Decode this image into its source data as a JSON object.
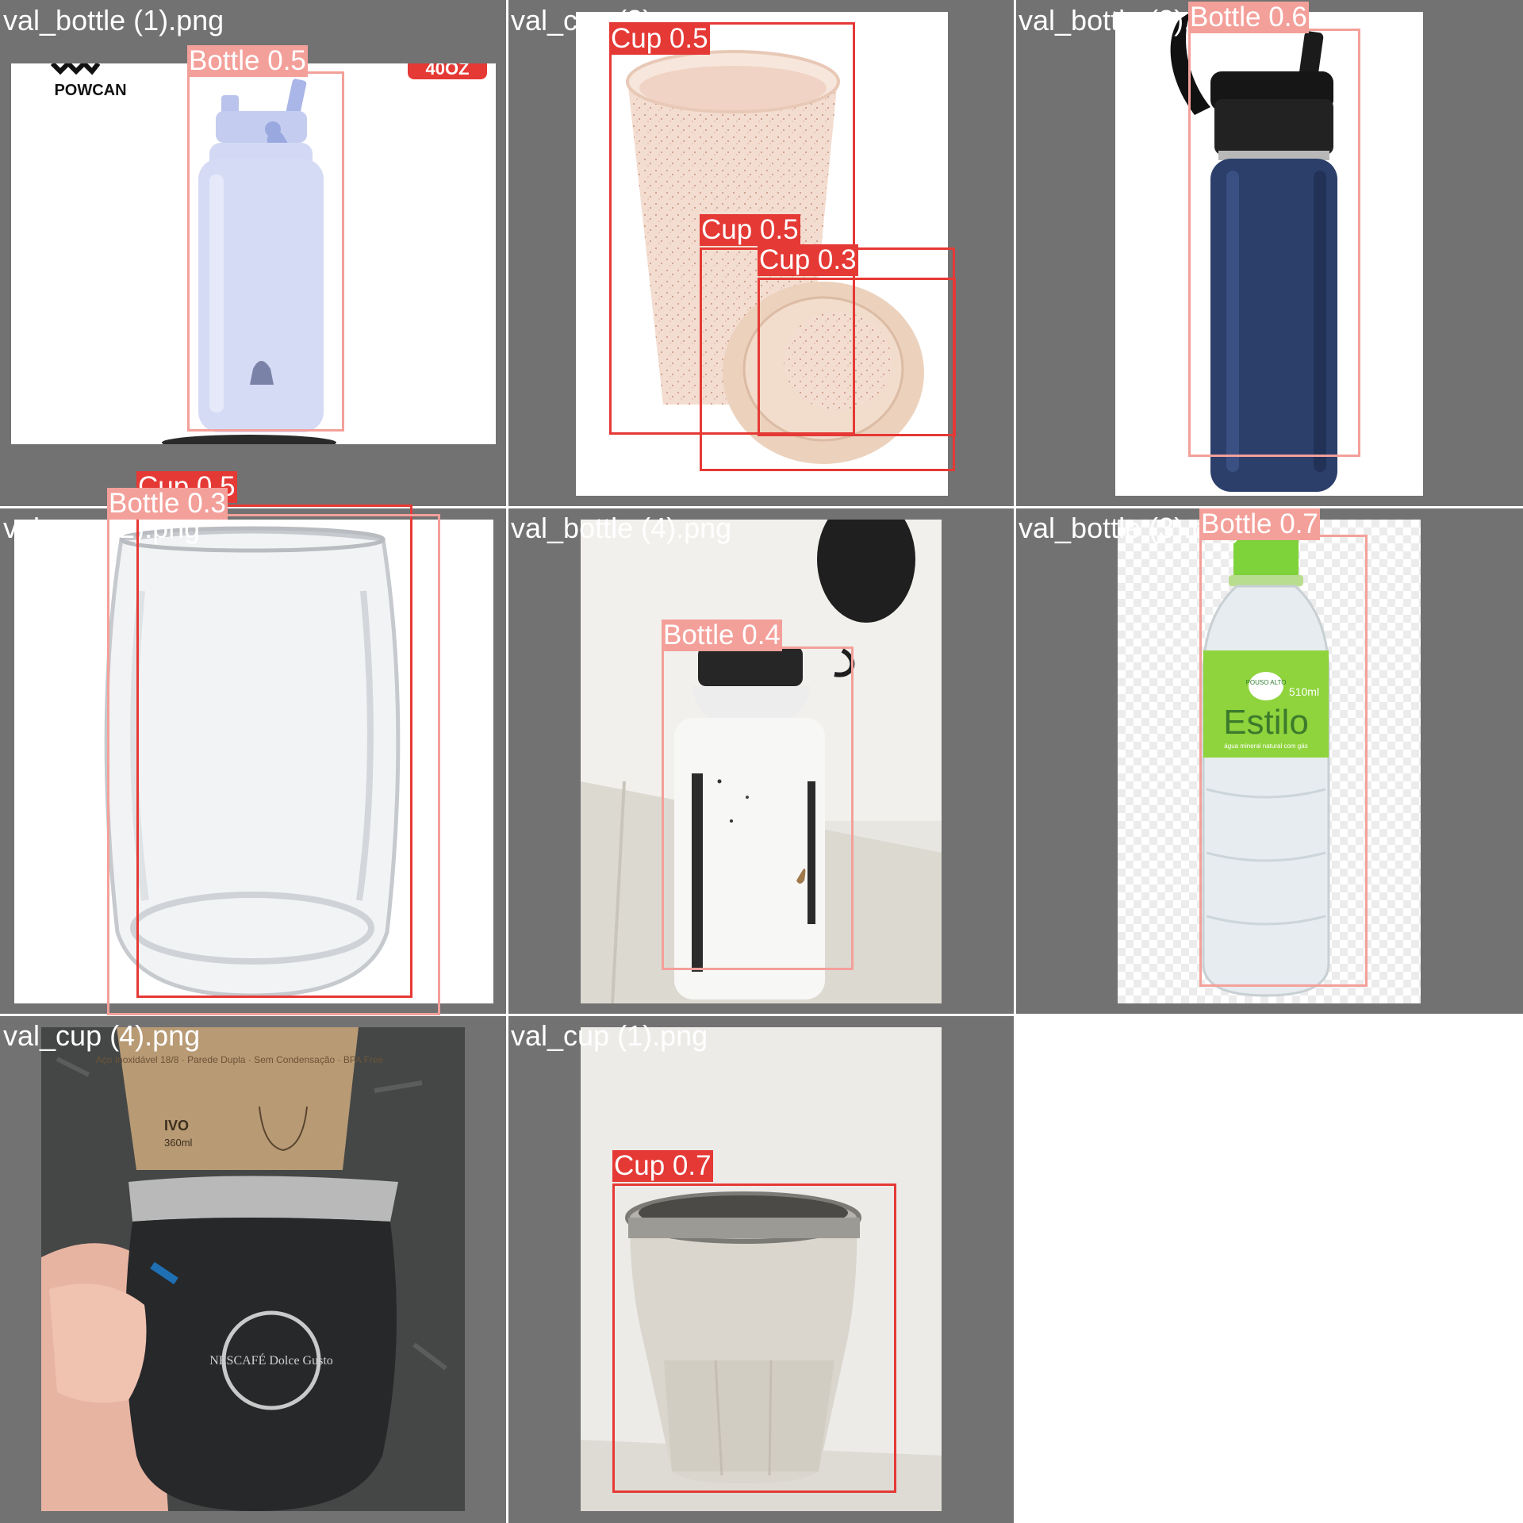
{
  "tiles": [
    {
      "filename": "val_bottle (1).png",
      "brand": "POWCAN",
      "badge": "40OZ"
    },
    {
      "filename": "val_cup (3).png"
    },
    {
      "filename": "val_bottle (2).png"
    },
    {
      "filename": "val_cup (2).png"
    },
    {
      "filename": "val_bottle (4).png"
    },
    {
      "filename": "val_bottle (3).png",
      "label_brand": "Estilo",
      "label_volume": "510ml",
      "label_sub": "água mineral natural com gás",
      "label_badge": "POUSO ALTO"
    },
    {
      "filename": "val_cup (4).png",
      "box_text": "Aço Inoxidável 18/8 · Parede Dupla · Sem Condensação · BPA Free",
      "box_name": "IVO",
      "box_volume": "360ml",
      "logo_text": "NESCAFÉ Dolce Gusto"
    },
    {
      "filename": "val_cup (1).png"
    }
  ],
  "detections": [
    {
      "label": "Bottle 0.5",
      "class": "Bottle"
    },
    {
      "label": "Cup 0.5",
      "class": "Cup"
    },
    {
      "label": "Cup 0.5",
      "class": "Cup"
    },
    {
      "label": "Cup 0.3",
      "class": "Cup"
    },
    {
      "label": "Bottle 0.6",
      "class": "Bottle"
    },
    {
      "label": "Cup 0.5",
      "class": "Cup"
    },
    {
      "label": "Bottle 0.3",
      "class": "Bottle"
    },
    {
      "label": "Bottle 0.4",
      "class": "Bottle"
    },
    {
      "label": "Bottle 0.7",
      "class": "Bottle"
    },
    {
      "label": "Cup 0.7",
      "class": "Cup"
    }
  ],
  "colors": {
    "cup": "#e53935",
    "bottle": "#f4a09a",
    "tile_bg": "#727272"
  }
}
